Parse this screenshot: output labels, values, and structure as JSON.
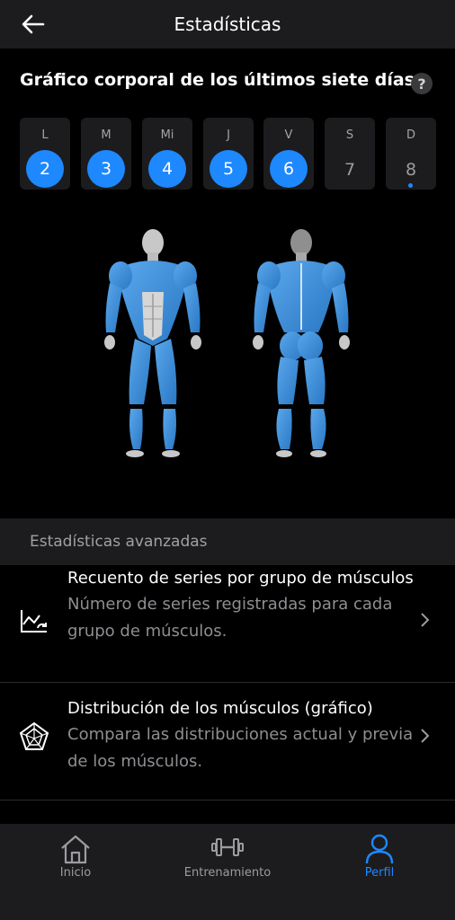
{
  "header": {
    "title": "Estadísticas",
    "back_icon": "arrow-left-icon"
  },
  "body_chart": {
    "title": "Gráfico corporal de los últimos siete días",
    "help_label": "?",
    "days": [
      {
        "letter": "L",
        "number": "2",
        "active": true
      },
      {
        "letter": "M",
        "number": "3",
        "active": true
      },
      {
        "letter": "Mi",
        "number": "4",
        "active": true
      },
      {
        "letter": "J",
        "number": "5",
        "active": true
      },
      {
        "letter": "V",
        "number": "6",
        "active": true
      },
      {
        "letter": "S",
        "number": "7",
        "active": false
      },
      {
        "letter": "D",
        "number": "8",
        "active": false,
        "today": true
      }
    ]
  },
  "advanced": {
    "title": "Estadísticas avanzadas",
    "items": [
      {
        "title": "Recuento de series por grupo de músculos",
        "subtitle": "Número de series registradas para cada grupo de músculos.",
        "icon": "chart-trend-icon"
      },
      {
        "title": "Distribución de los músculos (gráfico)",
        "subtitle": "Compara las distribuciones actual y previa de los músculos.",
        "icon": "radar-chart-icon"
      }
    ]
  },
  "tabbar": {
    "tabs": [
      {
        "label": "Inicio",
        "icon": "home-icon",
        "active": false
      },
      {
        "label": "Entrenamiento",
        "icon": "dumbbell-icon",
        "active": false
      },
      {
        "label": "Perfil",
        "icon": "user-icon",
        "active": true
      }
    ]
  },
  "colors": {
    "accent": "#1e88ff",
    "muscle": "#3b8fd9",
    "background": "#000000",
    "surface": "#1c1c1e"
  }
}
